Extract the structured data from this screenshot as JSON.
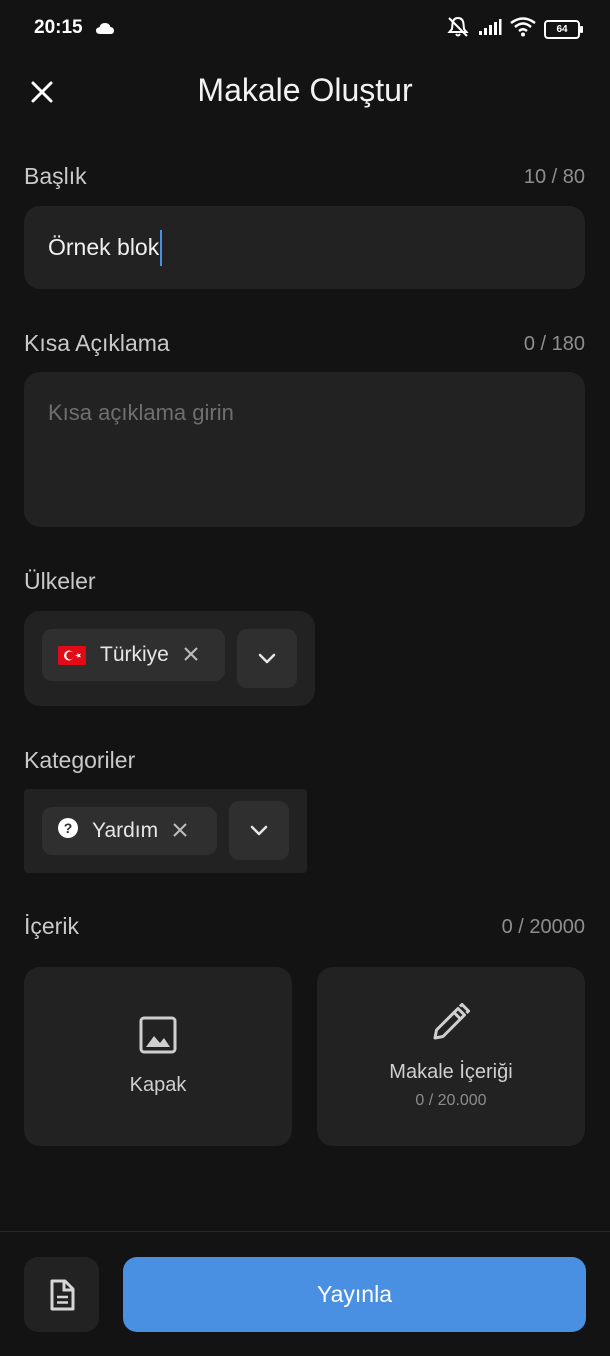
{
  "status_bar": {
    "time": "20:15",
    "battery": "64"
  },
  "header": {
    "title": "Makale Oluştur"
  },
  "title_field": {
    "label": "Başlık",
    "counter": "10 / 80",
    "value": "Örnek blok"
  },
  "description_field": {
    "label": "Kısa Açıklama",
    "counter": "0 / 180",
    "placeholder": "Kısa açıklama girin"
  },
  "countries": {
    "label": "Ülkeler",
    "selected": [
      {
        "label": "Türkiye",
        "icon": "turkey-flag-icon"
      }
    ]
  },
  "categories": {
    "label": "Kategoriler",
    "selected": [
      {
        "label": "Yardım",
        "icon": "help-circle-icon"
      }
    ]
  },
  "content": {
    "label": "İçerik",
    "counter": "0 / 20000",
    "cover_card": {
      "label": "Kapak",
      "icon": "image-icon"
    },
    "article_card": {
      "label": "Makale İçeriği",
      "sublabel": "0 / 20.000",
      "icon": "pencil-icon"
    }
  },
  "footer": {
    "doc_icon": "document-icon",
    "publish_label": "Yayınla"
  },
  "colors": {
    "background": "#131313",
    "surface": "#222222",
    "chip": "#2f2f2f",
    "accent": "#4a90e2"
  }
}
